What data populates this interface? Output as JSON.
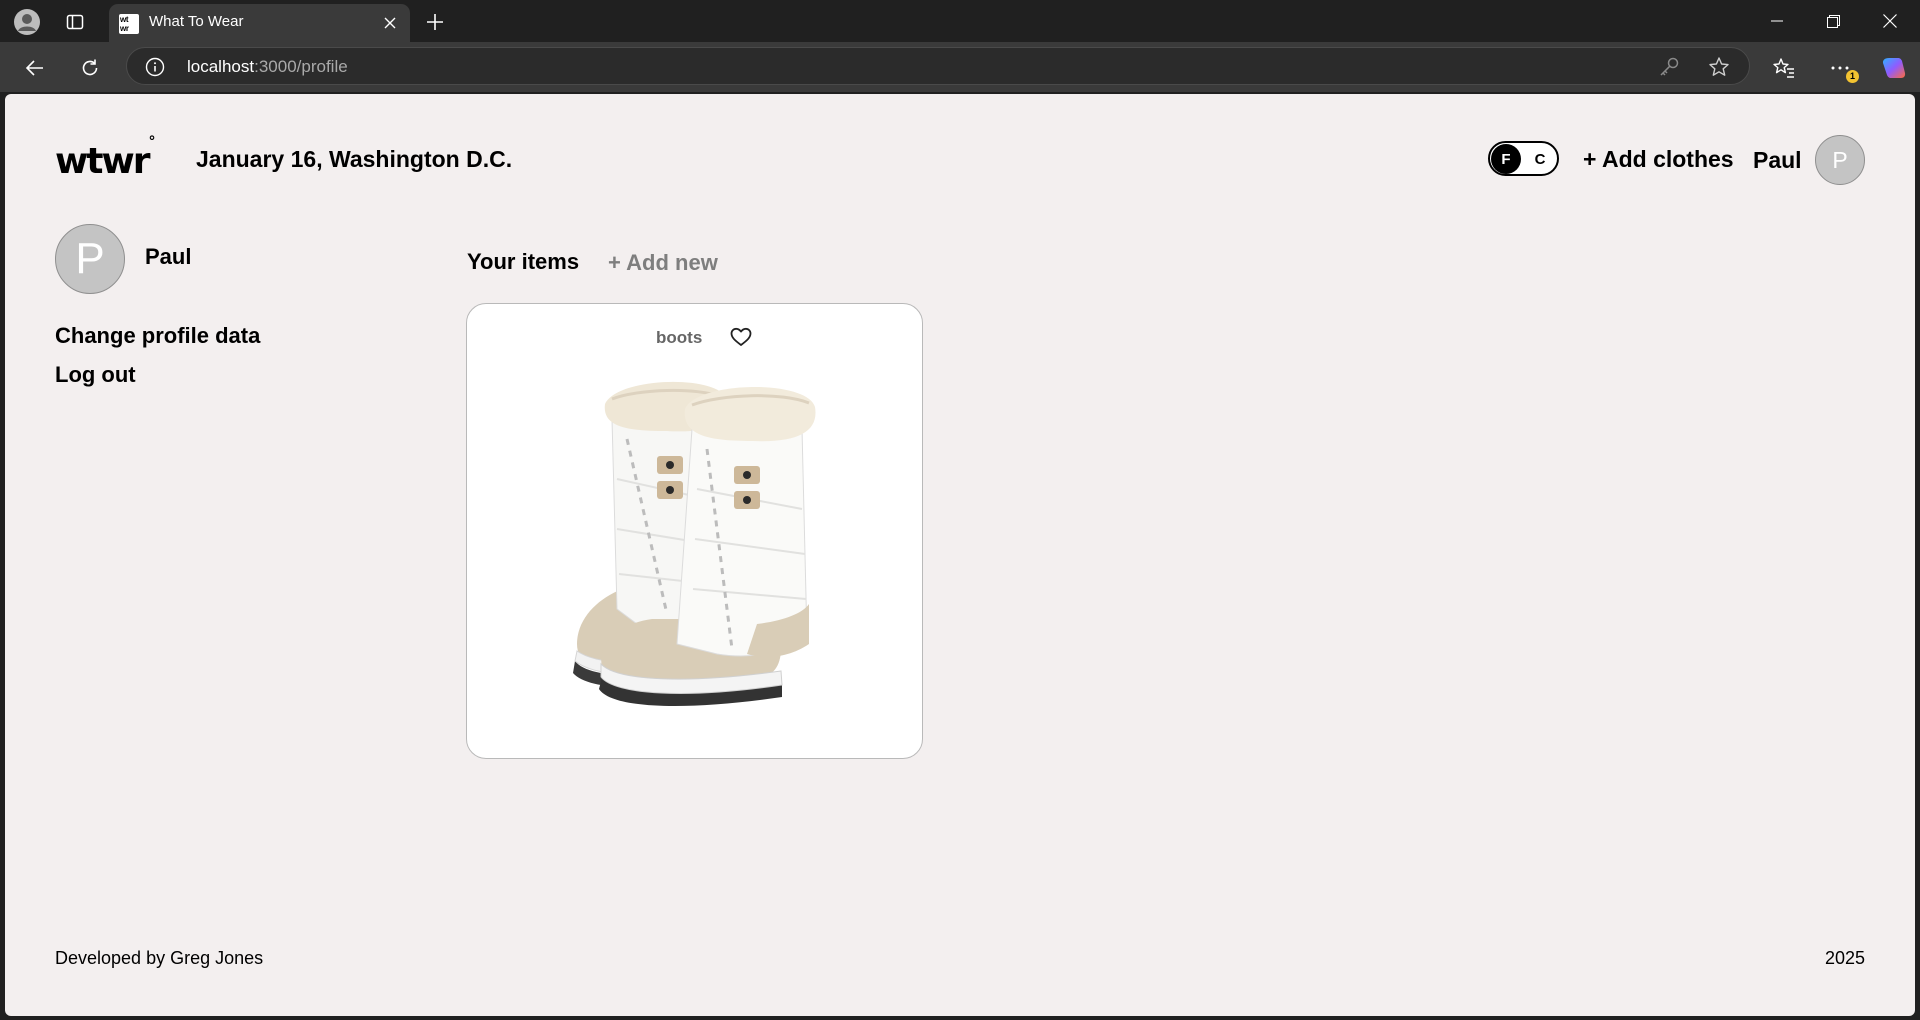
{
  "browser": {
    "tab_title": "What To Wear",
    "favicon_text": "wt wr",
    "url_host": "localhost",
    "url_path": ":3000/profile",
    "extension_badge": "1"
  },
  "header": {
    "logo": "wtwr",
    "logo_mark": "°",
    "date_location": "January 16, Washington D.C.",
    "toggle": {
      "f": "F",
      "c": "C",
      "active": "F"
    },
    "add_clothes": "+ Add clothes",
    "username": "Paul",
    "avatar_initial": "P"
  },
  "sidebar": {
    "avatar_initial": "P",
    "username": "Paul",
    "change_profile": "Change profile data",
    "log_out": "Log out"
  },
  "items": {
    "title": "Your items",
    "add_new": "+ Add new",
    "cards": [
      {
        "name": "boots",
        "liked": false
      }
    ]
  },
  "footer": {
    "credit": "Developed by Greg Jones",
    "year": "2025"
  },
  "colors": {
    "page_background": "#f3efef",
    "chrome_dark": "#202020",
    "chrome_toolbar": "#3a3a3a",
    "avatar_gray": "#c4c4c4",
    "muted_text": "#7e7e7e"
  },
  "icons": [
    "profile-icon",
    "workspaces-icon",
    "close-icon",
    "plus-icon",
    "minimize-icon",
    "restore-icon",
    "back-icon",
    "refresh-icon",
    "info-icon",
    "key-icon",
    "star-icon",
    "favorites-icon",
    "more-icon",
    "copilot-icon",
    "heart-icon"
  ]
}
